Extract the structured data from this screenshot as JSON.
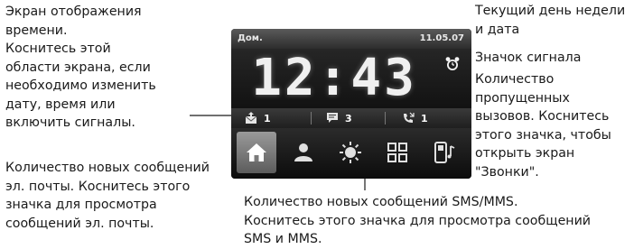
{
  "annotations": {
    "clock_area": "Экран отображения\nвремени.\nКоснитесь этой\nобласти экрана, если\nнеобходимо изменить\nдату, время или\nвключить сигналы.",
    "date_day": "Текущий день недели\nи дата",
    "alarm_icon": "Значок сигнала",
    "missed_calls": "Количество\nпропущенных\nвызовов. Коснитесь\nэтого значка, чтобы\nоткрыть экран\n\"Звонки\".",
    "new_email": "Количество новых сообщений\nэл. почты. Коснитесь этого\nзначка для просмотра\nсообщений эл. почты.",
    "new_sms": "Количество новых сообщений SMS/MMS.\nКоснитесь этого значка для просмотра сообщений\nSMS и MMS."
  },
  "device": {
    "status_bar": {
      "location": "Дом.",
      "date": "11.05.07"
    },
    "clock": {
      "time": "12:43"
    },
    "counters": {
      "email": "1",
      "sms": "3",
      "missed_calls": "1"
    },
    "tabs": [
      "home-icon",
      "contacts-icon",
      "weather-icon",
      "programs-icon",
      "music-icon"
    ]
  },
  "colors": {
    "device_bg": "#141414",
    "text": "#1a1a1a",
    "active_tab": "#7a7a7a"
  }
}
